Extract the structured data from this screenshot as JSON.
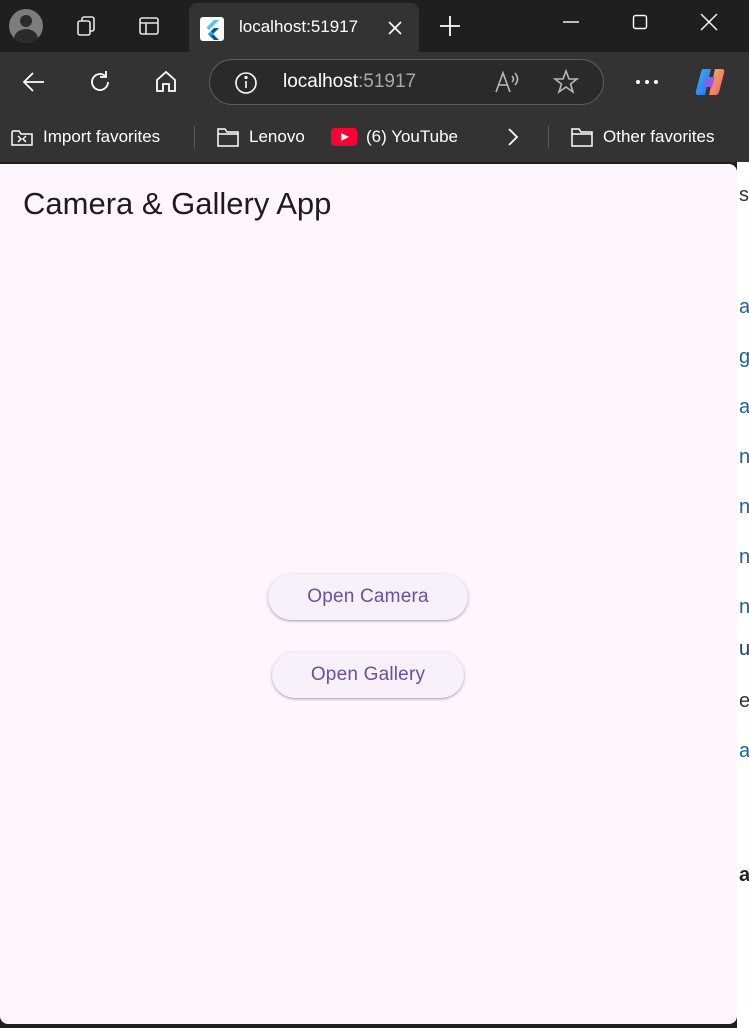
{
  "browser": {
    "tab": {
      "title": "localhost:51917"
    },
    "address": {
      "host": "localhost",
      "port": ":51917"
    },
    "favorites": [
      {
        "label": "Import favorites"
      },
      {
        "label": "Lenovo"
      },
      {
        "label": "(6) YouTube"
      },
      {
        "label": "Other favorites"
      }
    ],
    "colors": {
      "chrome_dark": "#1f1f1f",
      "chrome": "#333333"
    }
  },
  "app": {
    "title": "Camera & Gallery App",
    "buttons": {
      "camera": "Open Camera",
      "gallery": "Open Gallery"
    },
    "colors": {
      "background": "#fdf7fd",
      "primary": "#6750a4",
      "button_bg": "#f6f0f8"
    }
  },
  "background_page": {
    "visible_glyphs": [
      "s",
      "a",
      "g",
      "a",
      "n",
      "n",
      "n",
      "n",
      "u",
      "e",
      "a",
      "a"
    ]
  }
}
